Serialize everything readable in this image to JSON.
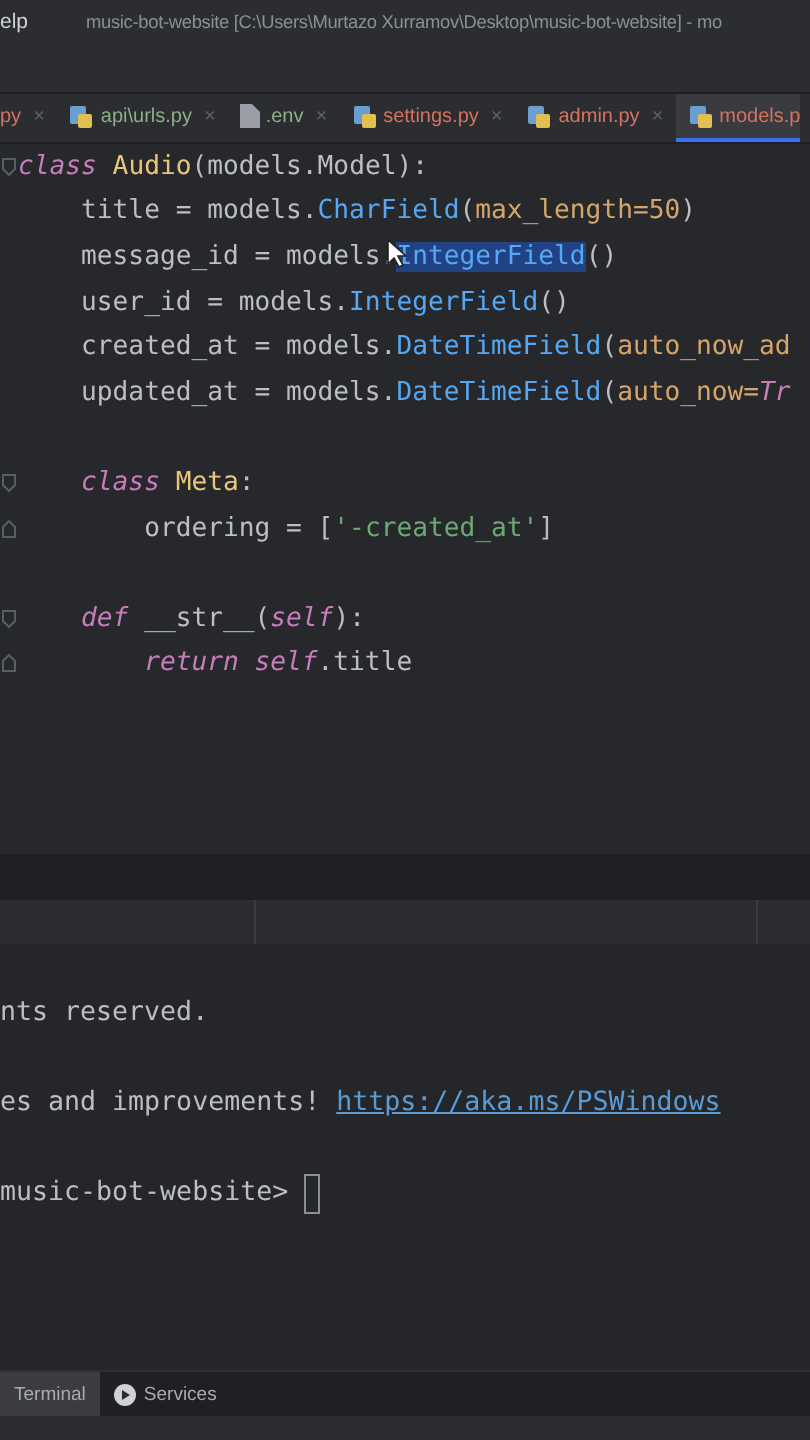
{
  "menu": {
    "item": "elp"
  },
  "window": {
    "title": "music-bot-website [C:\\Users\\Murtazo Xurramov\\Desktop\\music-bot-website] - mo"
  },
  "tabs": [
    {
      "label": "py",
      "close": "×",
      "color": "#d5735f",
      "selected": false
    },
    {
      "label": "api\\urls.py",
      "kind": "python",
      "close": "×",
      "color": "#8fae87",
      "selected": false
    },
    {
      "label": ".env",
      "kind": "file",
      "close": "×",
      "color": "#8fae87",
      "selected": false
    },
    {
      "label": "settings.py",
      "kind": "python",
      "close": "×",
      "color": "#d5735f",
      "selected": false
    },
    {
      "label": "admin.py",
      "kind": "python",
      "close": "×",
      "color": "#d5735f",
      "selected": false
    },
    {
      "label": "models.p",
      "kind": "python",
      "color": "#d5735f",
      "selected": true
    }
  ],
  "editor": {
    "lines": [
      {
        "kind": "code",
        "foldable": true,
        "tokens": [
          {
            "kind": "keyword",
            "text": "class"
          },
          {
            "kind": "classname",
            "text": " Audio"
          },
          {
            "kind": "plain",
            "text": "(models.Model):"
          }
        ],
        "children": [
          {
            "kind": "code",
            "tokens": [
              {
                "kind": "plain",
                "text": "title = models."
              },
              {
                "kind": "call",
                "text": "CharField"
              },
              {
                "kind": "plain",
                "text": "("
              },
              {
                "kind": "param",
                "text": "max_length=50"
              },
              {
                "kind": "plain",
                "text": ")"
              }
            ]
          },
          {
            "kind": "code",
            "tokens": [
              {
                "kind": "plain",
                "text": "message_id = models."
              },
              {
                "kind": "selection",
                "text": "IntegerField"
              },
              {
                "kind": "plain",
                "text": "()"
              }
            ]
          },
          {
            "kind": "code",
            "tokens": [
              {
                "kind": "plain",
                "text": "user_id = models."
              },
              {
                "kind": "call",
                "text": "IntegerField"
              },
              {
                "kind": "plain",
                "text": "()"
              }
            ]
          },
          {
            "kind": "code",
            "tokens": [
              {
                "kind": "plain",
                "text": "created_at = models."
              },
              {
                "kind": "call",
                "text": "DateTimeField"
              },
              {
                "kind": "plain",
                "text": "("
              },
              {
                "kind": "param",
                "text": "auto_now_ad"
              }
            ]
          },
          {
            "kind": "code",
            "tokens": [
              {
                "kind": "plain",
                "text": "updated_at = models."
              },
              {
                "kind": "call",
                "text": "DateTimeField"
              },
              {
                "kind": "plain",
                "text": "("
              },
              {
                "kind": "param",
                "text": "auto_now="
              },
              {
                "kind": "keyword",
                "text": "Tr"
              }
            ]
          },
          {
            "kind": "blank"
          },
          {
            "kind": "code",
            "foldable": true,
            "tokens": [
              {
                "kind": "keyword",
                "text": "class"
              },
              {
                "kind": "classname",
                "text": " Meta"
              },
              {
                "kind": "plain",
                "text": ":"
              }
            ],
            "children": [
              {
                "kind": "code",
                "tokens": [
                  {
                    "kind": "plain",
                    "text": "ordering = ["
                  },
                  {
                    "kind": "string",
                    "text": "'-created_at'"
                  },
                  {
                    "kind": "plain",
                    "text": "]"
                  }
                ]
              }
            ]
          },
          {
            "kind": "blank"
          },
          {
            "kind": "code",
            "foldable": true,
            "tokens": [
              {
                "kind": "keyword",
                "text": "def"
              },
              {
                "kind": "plain",
                "text": " __str__("
              },
              {
                "kind": "keyword",
                "text": "self"
              },
              {
                "kind": "plain",
                "text": "):"
              }
            ],
            "children": [
              {
                "kind": "code",
                "tokens": [
                  {
                    "kind": "keyword",
                    "text": "return self"
                  },
                  {
                    "kind": "plain",
                    "text": ".title"
                  }
                ]
              }
            ]
          }
        ]
      }
    ]
  },
  "terminal": {
    "lines": [
      {
        "cursor": false,
        "tokens": [
          {
            "kind": "text",
            "text": "nts reserved."
          }
        ]
      },
      {
        "cursor": false,
        "tokens": [
          {
            "kind": "text",
            "text": "es and improvements! "
          },
          {
            "kind": "link",
            "text": "https://aka.ms/PSWindows"
          }
        ]
      },
      {
        "cursor": true,
        "tokens": [
          {
            "kind": "text",
            "text": "music-bot-website> "
          }
        ]
      }
    ]
  },
  "tool_tabs": [
    {
      "label": "Terminal",
      "selected": true
    },
    {
      "label": "Services",
      "kind": "play",
      "selected": false
    }
  ]
}
